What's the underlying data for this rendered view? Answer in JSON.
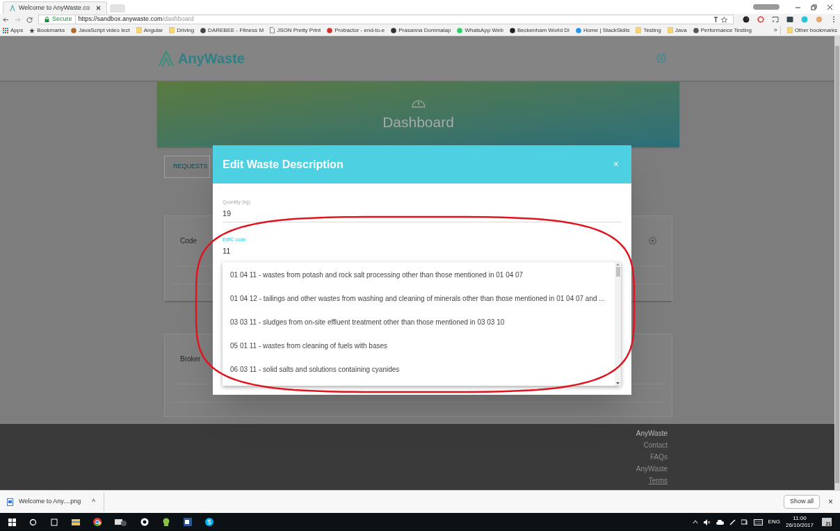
{
  "browser": {
    "tabs": [
      {
        "title": "Welcome to AnyWaste.co",
        "selected": true
      }
    ],
    "address": {
      "secure_label": "Secure",
      "url_host": "https://sandbox.anywaste.com",
      "url_path": "/dashboard"
    },
    "bookmarks": [
      {
        "kind": "apps",
        "label": "Apps"
      },
      {
        "kind": "star",
        "label": "Bookmarks"
      },
      {
        "kind": "site",
        "label": "JavaScript video lect",
        "color": "#b06a2c"
      },
      {
        "kind": "folder",
        "label": "Angular"
      },
      {
        "kind": "folder",
        "label": "Driving"
      },
      {
        "kind": "site",
        "label": "DAREBEE - Fitness M",
        "color": "#444444"
      },
      {
        "kind": "page",
        "label": "JSON Pretty Print"
      },
      {
        "kind": "site",
        "label": "Protractor - end-to-e",
        "color": "#d32f2f"
      },
      {
        "kind": "site",
        "label": "Prasanna Dommalap",
        "color": "#333333"
      },
      {
        "kind": "site",
        "label": "WhatsApp Web",
        "color": "#25d366"
      },
      {
        "kind": "site",
        "label": "Beckenham World Di",
        "color": "#222222"
      },
      {
        "kind": "site",
        "label": "Home | StackSkills",
        "color": "#2196f3"
      },
      {
        "kind": "folder",
        "label": "Testing"
      },
      {
        "kind": "folder",
        "label": "Java"
      },
      {
        "kind": "site",
        "label": "Performance Testing",
        "color": "#555555"
      }
    ],
    "overflow": "»",
    "other_bookmarks": "Other bookmarks"
  },
  "app": {
    "logo": "AnyWaste",
    "hero_title": "Dashboard",
    "requests_button": "REQUESTS",
    "cards": [
      {
        "label": "Code"
      },
      {
        "label": "Broker"
      }
    ],
    "footer_links": [
      "AnyWaste",
      "Contact",
      "FAQs",
      "AnyWaste",
      "Terms"
    ]
  },
  "modal": {
    "title": "Edit Waste Description",
    "close": "×",
    "fields": [
      {
        "label": "Quantity (kg)",
        "value": "19",
        "focused": false
      },
      {
        "label": "EWC code",
        "value": "11",
        "focused": true
      }
    ],
    "options": [
      "01 04 11 - wastes from potash and rock salt processing other than those mentioned in 01 04 07",
      "01 04 12 - tailings and other wastes from washing and cleaning of minerals other than those mentioned in 01 04 07 and ...",
      "03 03 11 - sludges from on-site effluent treatment other than those mentioned in 03 03 10",
      "05 01 11 - wastes from cleaning of fuels with bases",
      "06 03 11 - solid salts and solutions containing cyanides"
    ]
  },
  "downloads": {
    "file": "Welcome to Any....png",
    "caret": "^",
    "show_all": "Show all",
    "close": "×"
  },
  "taskbar": {
    "language": "ENG",
    "time": "11:00",
    "date": "26/10/2017",
    "notifications": "21"
  }
}
